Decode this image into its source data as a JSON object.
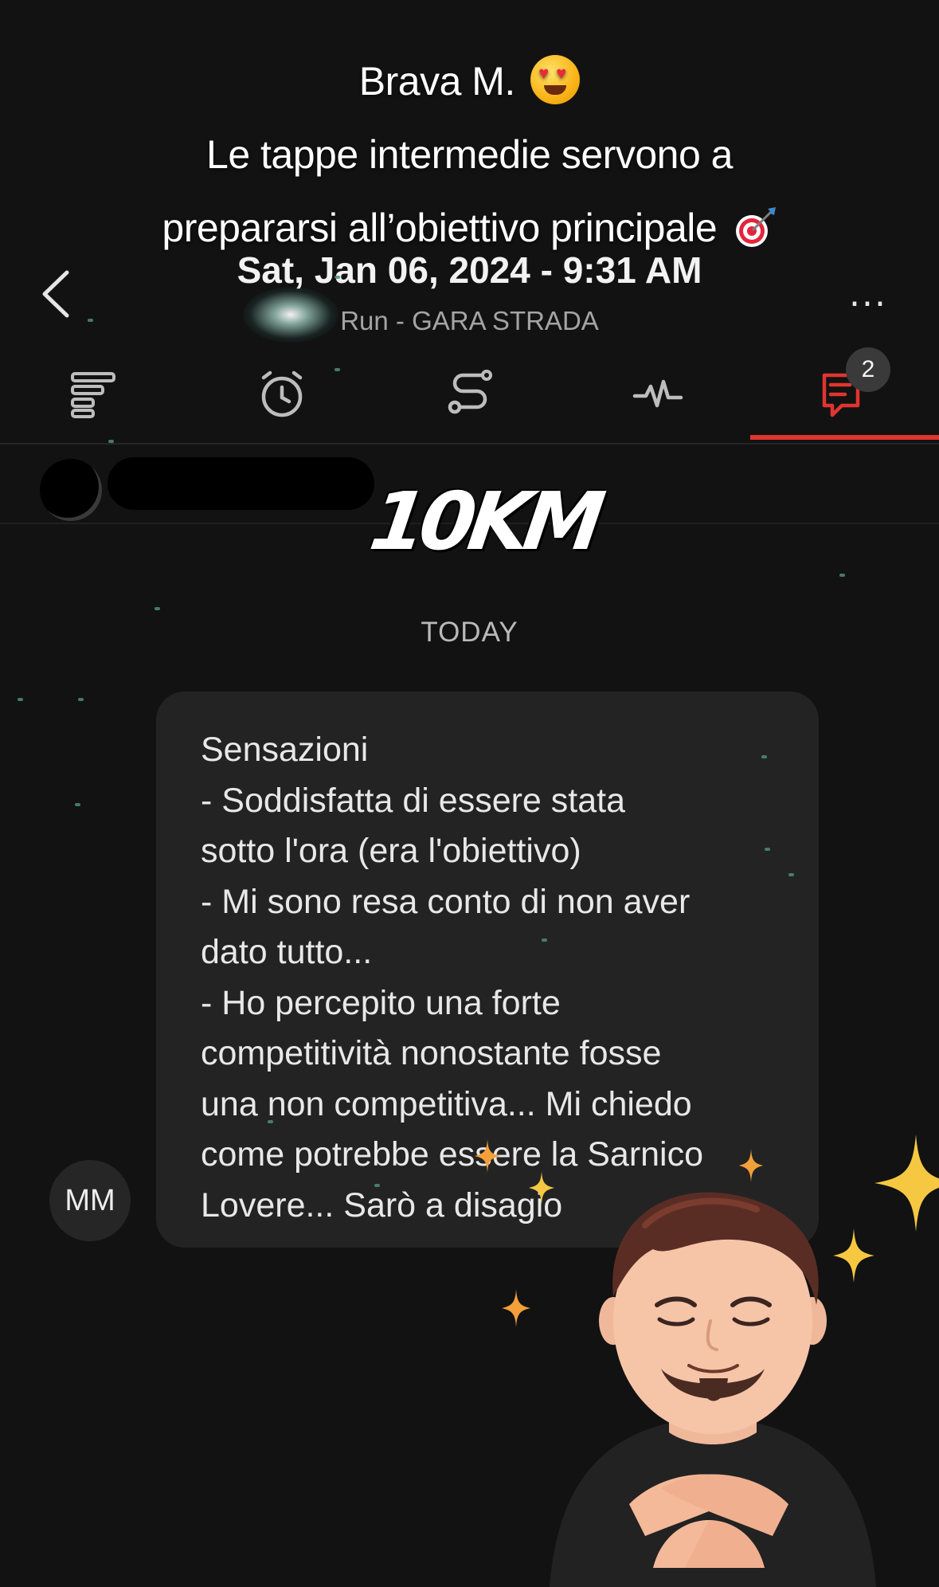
{
  "story_caption": {
    "line1": "Brava M.",
    "line1_emoji": "heart-eyes-emoji",
    "line2": "Le tappe intermedie servono a",
    "line3": "prepararsi all’obiettivo principale",
    "line3_emoji": "bullseye-emoji"
  },
  "header": {
    "back_icon": "chevron-left-icon",
    "title": "Sat, Jan 06, 2024 - 9:31 AM",
    "subtitle": "Run - GARA STRADA",
    "more_icon": "ellipsis-icon",
    "more_label": "..."
  },
  "tabs": [
    {
      "name": "summary",
      "icon": "summary-bars-icon",
      "active": false
    },
    {
      "name": "laps",
      "icon": "stopwatch-icon",
      "active": false
    },
    {
      "name": "route",
      "icon": "route-icon",
      "active": false
    },
    {
      "name": "activity",
      "icon": "heartbeat-icon",
      "active": false
    },
    {
      "name": "comments",
      "icon": "comments-icon",
      "active": true,
      "badge": "2"
    }
  ],
  "sticker": {
    "text": "10KM"
  },
  "day_separator": "TODAY",
  "comment": {
    "author_initials": "MM",
    "lines": [
      "Sensazioni",
      "- Soddisfatta di essere stata",
      "sotto l'ora (era l'obiettivo)",
      "- Mi sono resa conto di non aver",
      "dato tutto...",
      "- Ho percepito una forte",
      "competitività nonostante fosse",
      "una non competitiva... Mi chiedo",
      "come potrebbe essere la Sarnico",
      "Lovere... Sarò a disagio"
    ]
  },
  "colors": {
    "background": "#121212",
    "accent": "#e0352f",
    "bubble": "#232323",
    "sparkle_gold": "#f6c842",
    "sparkle_orange": "#f3a03a"
  }
}
